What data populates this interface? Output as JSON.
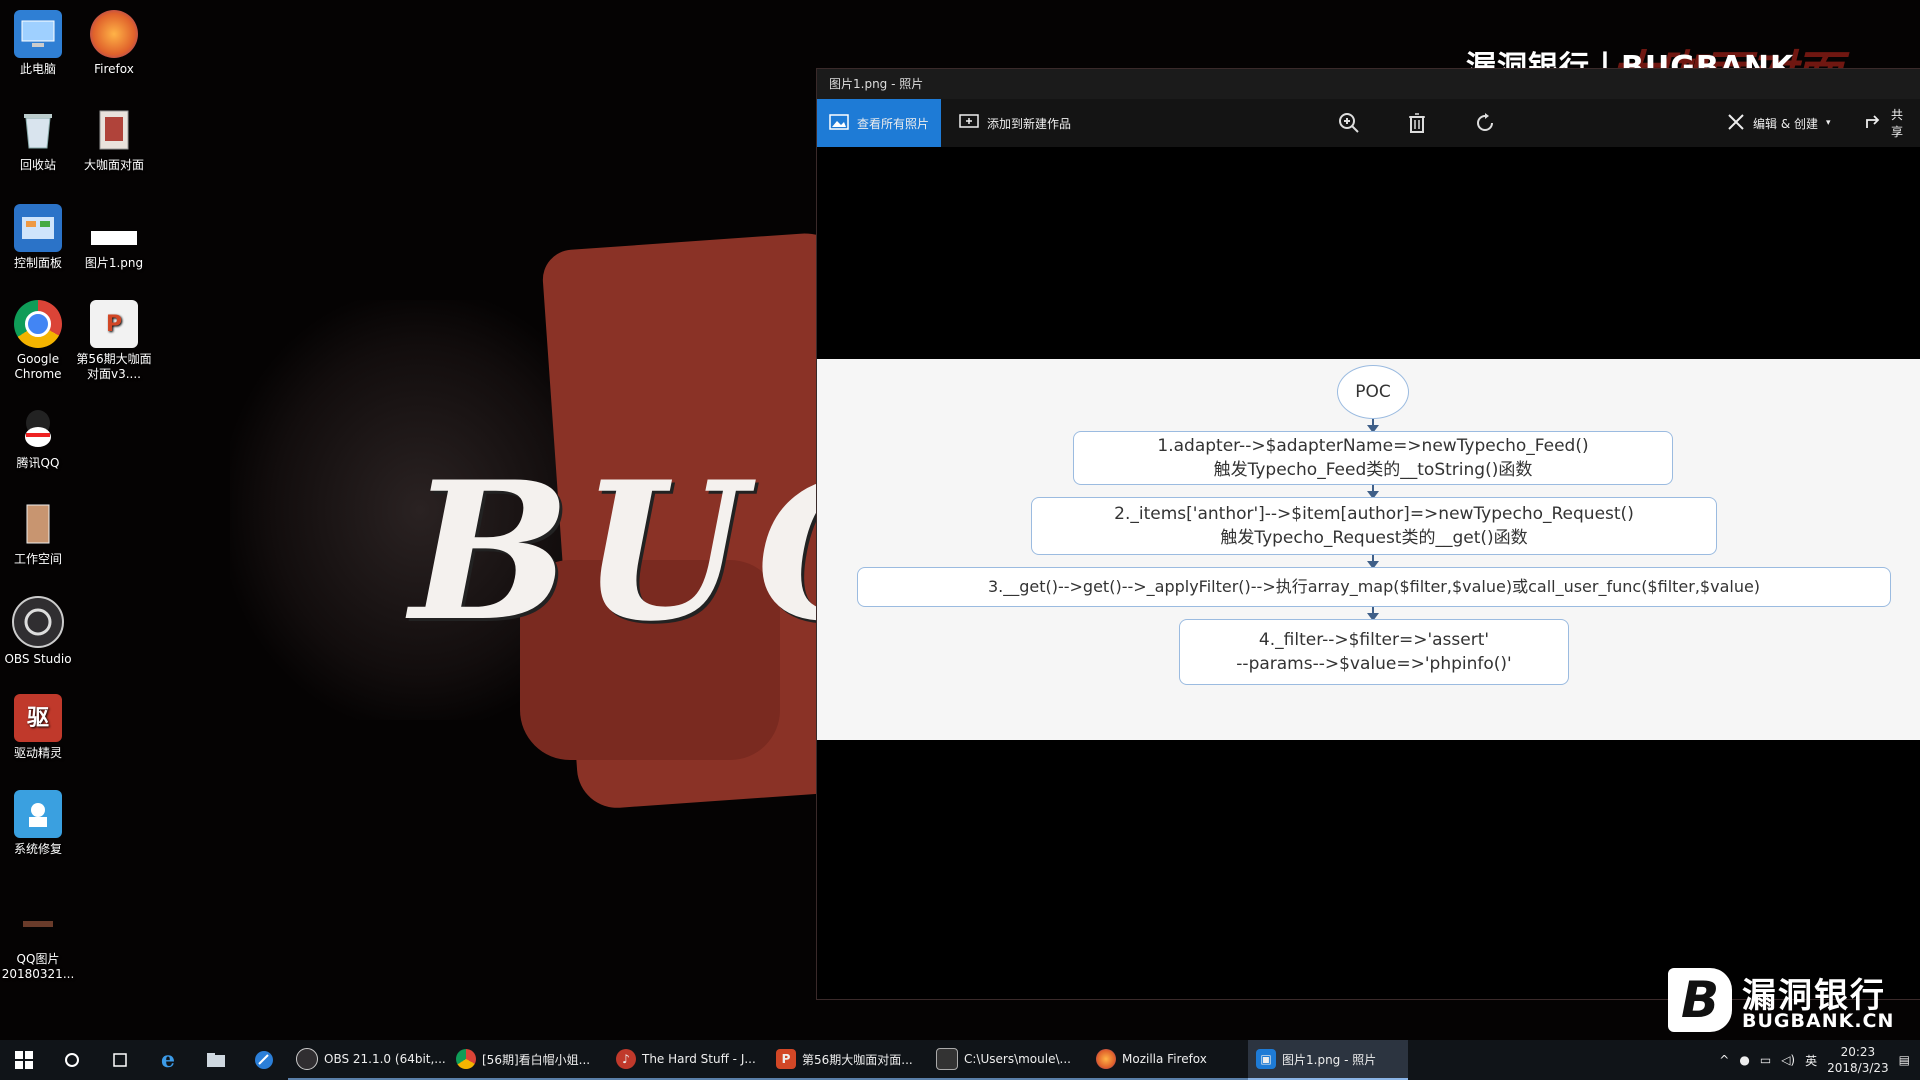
{
  "desktop_icons": [
    {
      "label": "此电脑",
      "icon": "computer-icon",
      "color": "#3b8ee0"
    },
    {
      "label": "Firefox",
      "icon": "firefox-icon",
      "color": "#e0622b"
    },
    {
      "label": "回收站",
      "icon": "recycle-bin-icon",
      "color": "#c8d6e4"
    },
    {
      "label": "大咖面对面",
      "icon": "document-icon",
      "color": "#c0392b"
    },
    {
      "label": "控制面板",
      "icon": "control-panel-icon",
      "color": "#2b73c8"
    },
    {
      "label": "图片1.png",
      "icon": "image-file-icon",
      "color": "#ffffff"
    },
    {
      "label": "Google Chrome",
      "icon": "chrome-icon",
      "color": "#db4437"
    },
    {
      "label": "第56期大咖面对面v3....",
      "icon": "powerpoint-icon",
      "color": "#d24726"
    },
    {
      "label": "腾讯QQ",
      "icon": "qq-icon",
      "color": "#222222"
    },
    {
      "label": "工作空间",
      "icon": "folder-icon",
      "color": "#b0744a"
    },
    {
      "label": "OBS Studio",
      "icon": "obs-icon",
      "color": "#302e31"
    },
    {
      "label": "驱动精灵",
      "icon": "driver-icon",
      "color": "#c0392b"
    },
    {
      "label": "系统修复",
      "icon": "repair-icon",
      "color": "#3aa0e0"
    },
    {
      "label": "QQ图片20180321...",
      "icon": "photo-icon",
      "color": "#3a2a20"
    }
  ],
  "window": {
    "title": "图片1.png - 照片",
    "toolbar": {
      "view_all": "查看所有照片",
      "add_to": "添加到新建作品",
      "edit_create": "编辑 & 创建",
      "share": "共享"
    }
  },
  "flowchart": {
    "start": "POC",
    "steps": [
      {
        "line1": "1.adapter-->$adapterName=>newTypecho_Feed()",
        "line2": "触发Typecho_Feed类的__toString()函数"
      },
      {
        "line1": "2._items['anthor']-->$item[author]=>newTypecho_Request()",
        "line2": "触发Typecho_Request类的__get()函数"
      },
      {
        "line1": "3.__get()-->get()-->_applyFilter()-->执行array_map($filter,$value)或call_user_func($filter,$value)",
        "line2": ""
      },
      {
        "line1": "4._filter-->$filter=>'assert'",
        "line2": "--params-->$value=>'phpinfo()'"
      }
    ]
  },
  "watermark": {
    "top_text": "漏洞银行丨BUGBANK",
    "top_red": "大咖面对面",
    "logo_letter": "B",
    "cn": "漏洞银行",
    "en": "BUGBANK.CN"
  },
  "wallpaper_text": "BUG",
  "taskbar": {
    "items": [
      {
        "label": "OBS 21.1.0 (64bit,...",
        "icon": "obs-icon"
      },
      {
        "label": "[56期]看白帽小姐...",
        "icon": "chrome-icon"
      },
      {
        "label": "The Hard Stuff - J...",
        "icon": "music-icon"
      },
      {
        "label": "第56期大咖面对面...",
        "icon": "powerpoint-icon"
      },
      {
        "label": "C:\\Users\\moule\\...",
        "icon": "terminal-icon"
      },
      {
        "label": "Mozilla Firefox",
        "icon": "firefox-icon"
      },
      {
        "label": "图片1.png - 照片",
        "icon": "photos-icon"
      }
    ],
    "ime": "英",
    "time": "20:23",
    "date": "2018/3/23"
  }
}
